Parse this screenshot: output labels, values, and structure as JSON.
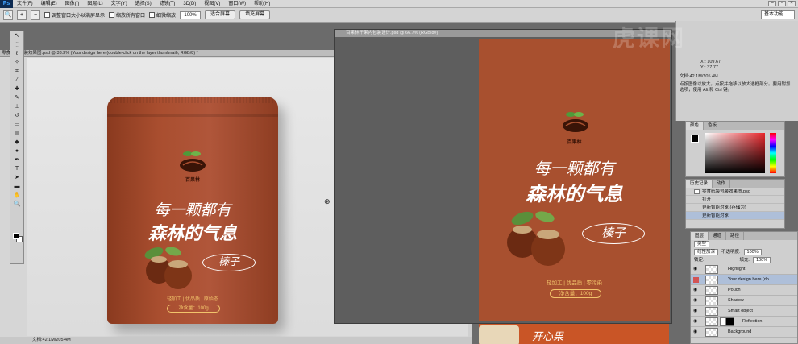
{
  "app": {
    "logo": "Ps",
    "menus": [
      "文件(F)",
      "编辑(E)",
      "图像(I)",
      "图层(L)",
      "文字(Y)",
      "选择(S)",
      "滤镜(T)",
      "3D(D)",
      "视图(V)",
      "窗口(W)",
      "帮助(H)"
    ]
  },
  "options": {
    "resize_windows": "调整窗口大小以满屏显示",
    "zoom_all": "缩放所有窗口",
    "scrubby": "细微缩放",
    "zoom_value": "100%",
    "fit_screen": "适合屏幕",
    "fill_screen": "填充屏幕",
    "workspace": "基本功能"
  },
  "doc1": {
    "tab": "零食纸袋包装效果图.psd @ 33.3% (Your design here (double-click on the layer thumbnail), RGB/8) *",
    "status": "文档:42.1M/205.4M"
  },
  "pouch": {
    "brand": "百果林",
    "slogan1": "每一颗都有",
    "slogan2": "森林的气息",
    "tag": "榛子",
    "features": "轻加工 | 优品质 | 原始态",
    "net": "净含量：100g"
  },
  "doc2": {
    "tab": "百果林干果内包装设计.psd @ 66.7% (RGB/8#)",
    "brand": "百果林",
    "slogan1": "每一颗都有",
    "slogan2": "森林的气息",
    "tag": "榛子",
    "features": "轻加工 | 优品质 | 零污染",
    "net": "净含量：100g"
  },
  "doc3": {
    "label": "开心果"
  },
  "watermark": "虎课网",
  "info": {
    "x_label": "X :",
    "x_value": "109.67",
    "y_label": "Y :",
    "y_value": "37.77",
    "doc": "文档:42.1M/205.4M",
    "hint": "点按图像以放大。点按并拖移以放大选框部分。要用附加选项，使用 Alt 和 Ctrl 键。"
  },
  "color_panel": {
    "tabs": [
      "颜色",
      "色板"
    ]
  },
  "history": {
    "tabs": [
      "历史记录",
      "动作"
    ],
    "items": [
      "零食纸袋包装效果图.psd",
      "打开",
      "更新智能对象 (存储为)",
      "更新智能对象"
    ]
  },
  "layers": {
    "tabs": [
      "图层",
      "通道",
      "路径"
    ],
    "filter": "类型",
    "blend": "线性加深",
    "opacity_label": "不透明度:",
    "opacity": "100%",
    "lock_label": "锁定:",
    "fill_label": "填充:",
    "fill": "100%",
    "rows": [
      "Highlight",
      "Your design here (do...",
      "Pouch",
      "Shadow",
      "Smart object",
      "Reflection",
      "Background"
    ]
  }
}
